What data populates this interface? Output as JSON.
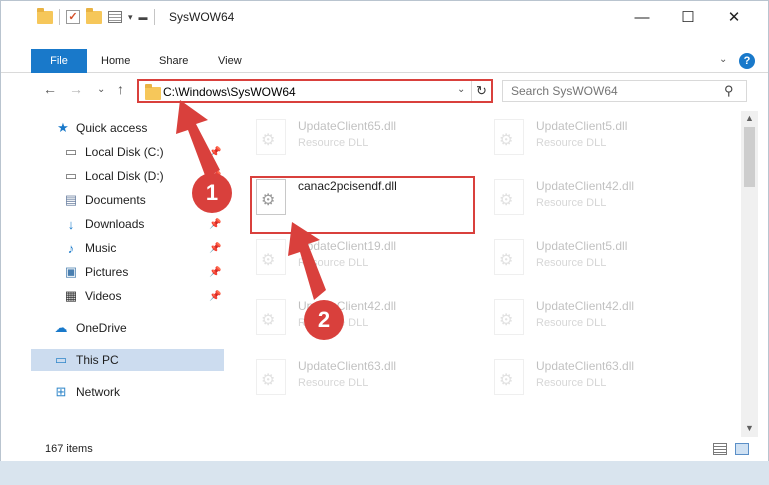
{
  "window": {
    "title": "SysWOW64",
    "minimize_glyph": "—",
    "maximize_glyph": "☐",
    "close_glyph": "✕"
  },
  "ribbon": {
    "file_label": "File",
    "tabs": [
      "Home",
      "Share",
      "View"
    ],
    "help_glyph": "?"
  },
  "nav": {
    "back_glyph": "←",
    "forward_glyph": "→",
    "recent_glyph": "⌄",
    "up_glyph": "↑"
  },
  "address": {
    "path": "C:\\Windows\\SysWOW64",
    "dropdown_glyph": "⌄",
    "refresh_glyph": "↻"
  },
  "search": {
    "placeholder": "Search SysWOW64",
    "icon": "search-icon"
  },
  "sidebar": {
    "items": [
      {
        "label": "Quick access",
        "icon": "star-icon",
        "pinned": false
      },
      {
        "label": "Local Disk (C:)",
        "icon": "drive-icon",
        "pinned": true
      },
      {
        "label": "Local Disk (D:)",
        "icon": "drive-icon",
        "pinned": true
      },
      {
        "label": "Documents",
        "icon": "documents-icon",
        "pinned": true
      },
      {
        "label": "Downloads",
        "icon": "download-icon",
        "pinned": true
      },
      {
        "label": "Music",
        "icon": "music-icon",
        "pinned": true
      },
      {
        "label": "Pictures",
        "icon": "pictures-icon",
        "pinned": true
      },
      {
        "label": "Videos",
        "icon": "videos-icon",
        "pinned": true
      },
      {
        "label": "OneDrive",
        "icon": "cloud-icon",
        "pinned": false
      },
      {
        "label": "This PC",
        "icon": "computer-icon",
        "pinned": false,
        "selected": true
      },
      {
        "label": "Network",
        "icon": "network-icon",
        "pinned": false
      }
    ]
  },
  "files": [
    {
      "name": "UpdateClient65.dll",
      "type": "Resource DLL",
      "faded": true
    },
    {
      "name": "UpdateClient5.dll",
      "type": "Resource DLL",
      "faded": true
    },
    {
      "name": "canac2pcisendf.dll",
      "type": "",
      "faded": false,
      "highlighted": true
    },
    {
      "name": "UpdateClient42.dll",
      "type": "Resource DLL",
      "faded": true
    },
    {
      "name": "UpdateClient19.dll",
      "type": "Resource DLL",
      "faded": true
    },
    {
      "name": "UpdateClient5.dll",
      "type": "Resource DLL",
      "faded": true
    },
    {
      "name": "UpdateClient42.dll",
      "type": "Resource DLL",
      "faded": true
    },
    {
      "name": "UpdateClient42.dll",
      "type": "Resource DLL",
      "faded": true
    },
    {
      "name": "UpdateClient63.dll",
      "type": "Resource DLL",
      "faded": true
    },
    {
      "name": "UpdateClient63.dll",
      "type": "Resource DLL",
      "faded": true
    }
  ],
  "status": {
    "item_count": "167 items"
  },
  "annotations": {
    "step1": "1",
    "step2": "2",
    "color": "#d9403c"
  },
  "colors": {
    "accent": "#1979ca",
    "selection": "#ccdcef",
    "highlight": "#d9403c"
  }
}
